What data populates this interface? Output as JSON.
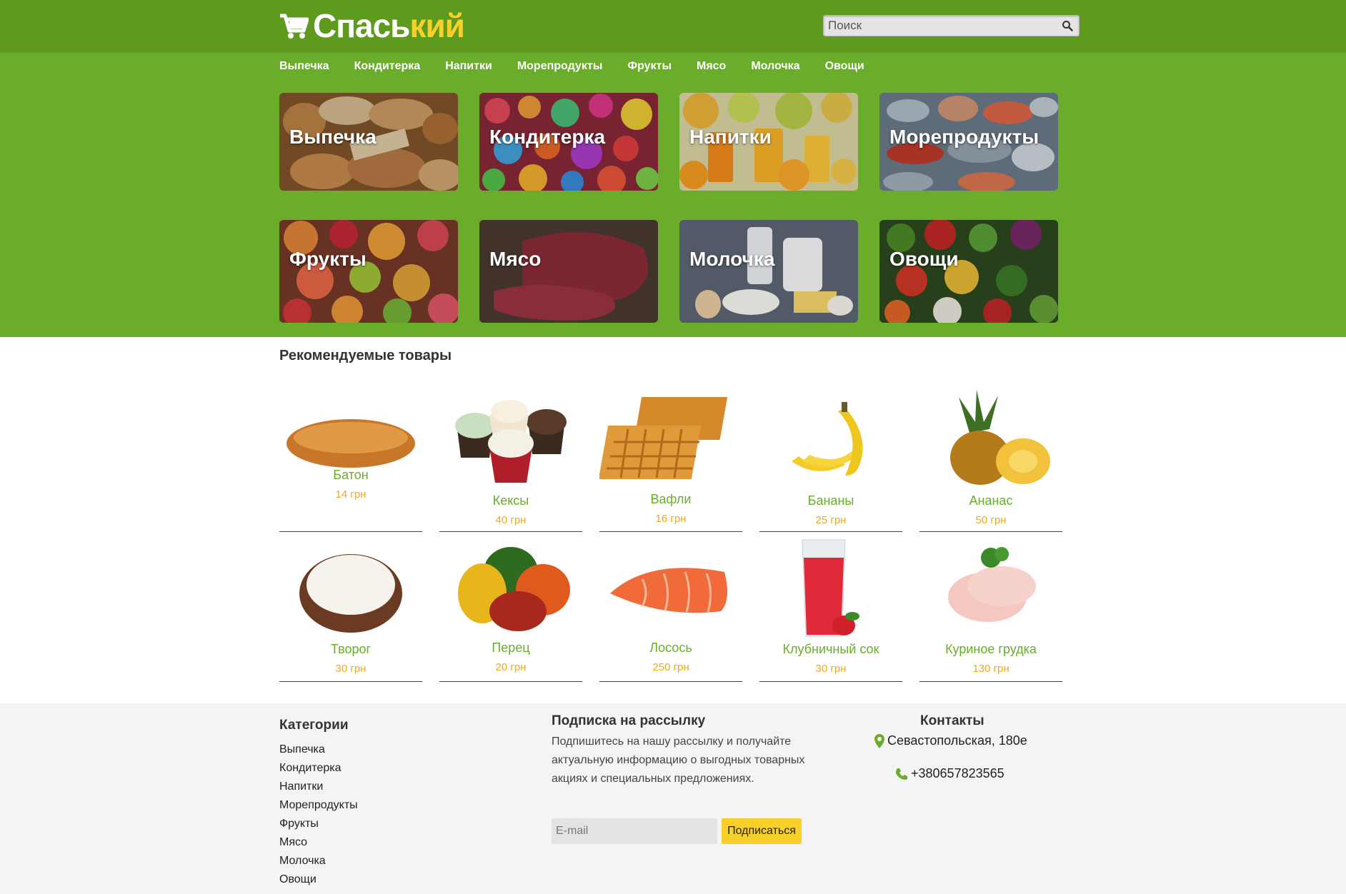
{
  "colors": {
    "header": "#5e9a1e",
    "hero": "#6aad2a",
    "accent_yellow": "#f7d12a",
    "price": "#f0a81c",
    "product_name": "#6aad2a",
    "footer": "#f4f4f4"
  },
  "header": {
    "logo_part1": "Спась",
    "logo_part2": "кий",
    "cart_icon": "cart-icon",
    "search_placeholder": "Поиск",
    "search_icon": "magnifier-icon"
  },
  "nav": [
    "Выпечка",
    "Кондитерка",
    "Напитки",
    "Морепродукты",
    "Фрукты",
    "Мясо",
    "Молочка",
    "Овощи"
  ],
  "categories": [
    {
      "label": "Выпечка",
      "image": "bakery-photo"
    },
    {
      "label": "Кондитерка",
      "image": "candy-photo"
    },
    {
      "label": "Напитки",
      "image": "juice-photo"
    },
    {
      "label": "Морепродукты",
      "image": "seafood-photo"
    },
    {
      "label": "Фрукты",
      "image": "fruits-photo"
    },
    {
      "label": "Мясо",
      "image": "meat-photo"
    },
    {
      "label": "Молочка",
      "image": "dairy-photo"
    },
    {
      "label": "Овощи",
      "image": "vegetables-photo"
    }
  ],
  "featured": {
    "title": "Рекомендуемые товары",
    "products": [
      {
        "name": "Батон",
        "price": "14 грн",
        "image": "bread"
      },
      {
        "name": "Кексы",
        "price": "40 грн",
        "image": "cupcakes"
      },
      {
        "name": "Вафли",
        "price": "16 грн",
        "image": "waffles"
      },
      {
        "name": "Бананы",
        "price": "25 грн",
        "image": "bananas"
      },
      {
        "name": "Ананас",
        "price": "50 грн",
        "image": "pineapple"
      },
      {
        "name": "Творог",
        "price": "30 грн",
        "image": "cottage-cheese"
      },
      {
        "name": "Перец",
        "price": "20 грн",
        "image": "peppers"
      },
      {
        "name": "Лосось",
        "price": "250 грн",
        "image": "salmon"
      },
      {
        "name": "Клубничный сок",
        "price": "30 грн",
        "image": "strawberry-juice"
      },
      {
        "name": "Куриное грудка",
        "price": "130 грн",
        "image": "chicken-breast"
      }
    ]
  },
  "footer": {
    "categories_title": "Категории",
    "categories": [
      "Выпечка",
      "Кондитерка",
      "Напитки",
      "Морепродукты",
      "Фрукты",
      "Мясо",
      "Молочка",
      "Овощи"
    ],
    "newsletter_title": "Подписка на рассылку",
    "newsletter_text": "Подпишитесь на нашу рассылку и получайте актуальную информацию о выгодных товарных акциях и специальных предложениях.",
    "email_placeholder": "E-mail",
    "subscribe_label": "Подписаться",
    "contacts_title": "Контакты",
    "address": "Севастопольская, 180е",
    "phone": "+380657823565"
  }
}
